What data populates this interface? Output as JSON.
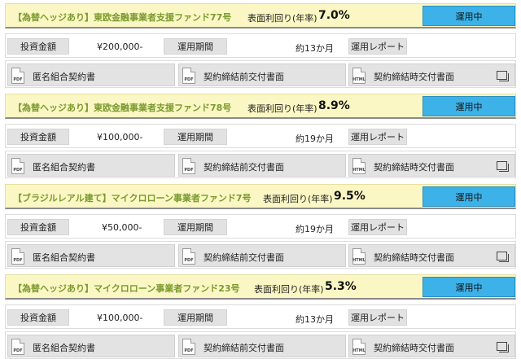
{
  "labels": {
    "yield_label": "表面利回り(年率)",
    "investment_label": "投資金額",
    "period_label": "運用期間",
    "report_button": "運用レポート"
  },
  "funds": [
    {
      "title": "【為替ヘッジあり】東欧金融事業者支援ファンド77号",
      "yield": "7.0%",
      "status": "運用中",
      "amount": "¥200,000-",
      "period": "約13か月",
      "documents": [
        {
          "type": "PDF",
          "label": "匿名組合契約書"
        },
        {
          "type": "PDF",
          "label": "契約締結前交付書面"
        },
        {
          "type": "HTML",
          "label": "契約締結時交付書面"
        }
      ]
    },
    {
      "title": "【為替ヘッジあり】東欧金融事業者支援ファンド78号",
      "yield": "8.9%",
      "status": "運用中",
      "amount": "¥100,000-",
      "period": "約19か月",
      "documents": [
        {
          "type": "PDF",
          "label": "匿名組合契約書"
        },
        {
          "type": "PDF",
          "label": "契約締結前交付書面"
        },
        {
          "type": "HTML",
          "label": "契約締結時交付書面"
        }
      ]
    },
    {
      "title": "【ブラジルレアル建て】マイクロローン事業者ファンド7号",
      "yield": "9.5%",
      "status": "運用中",
      "amount": "¥50,000-",
      "period": "約19か月",
      "documents": [
        {
          "type": "PDF",
          "label": "匿名組合契約書"
        },
        {
          "type": "PDF",
          "label": "契約締結前交付書面"
        },
        {
          "type": "HTML",
          "label": "契約締結時交付書面"
        }
      ]
    },
    {
      "title": "【為替ヘッジあり】マイクロローン事業者ファンド23号",
      "yield": "5.3%",
      "status": "運用中",
      "amount": "¥100,000-",
      "period": "約13か月",
      "documents": [
        {
          "type": "PDF",
          "label": "匿名組合契約書"
        },
        {
          "type": "PDF",
          "label": "契約締結前交付書面"
        },
        {
          "type": "HTML",
          "label": "契約締結時交付書面"
        }
      ]
    }
  ],
  "icons": {
    "pdf": "pdf-file-icon",
    "html": "html-file-icon",
    "open_window": "open-window-icon"
  },
  "colors": {
    "header_bg": "#fbf7c4",
    "title_text": "#7a9a2e",
    "status_button": "#3db2e9",
    "label_bg": "#e2e2e2"
  }
}
